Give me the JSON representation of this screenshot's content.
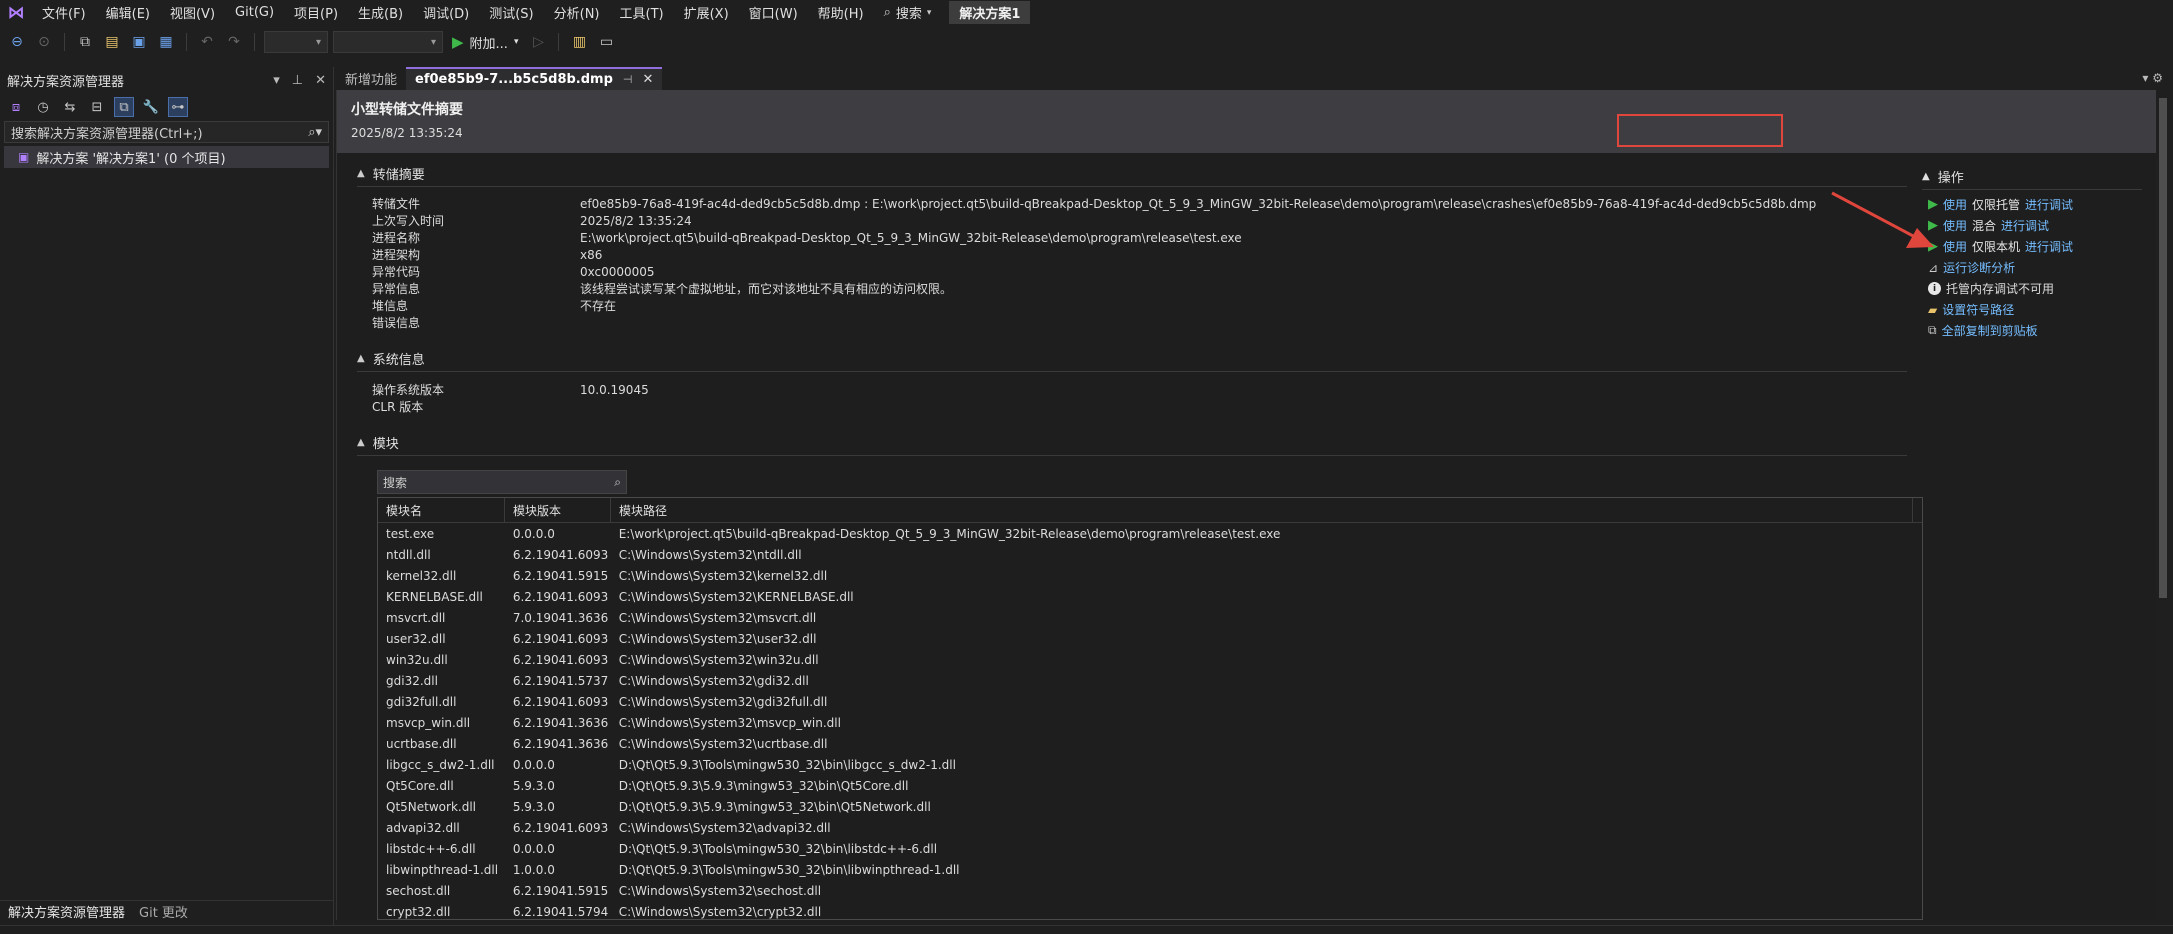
{
  "menubar": {
    "logo": "vs-logo",
    "items": [
      "文件(F)",
      "编辑(E)",
      "视图(V)",
      "Git(G)",
      "项目(P)",
      "生成(B)",
      "调试(D)",
      "测试(S)",
      "分析(N)",
      "工具(T)",
      "扩展(X)",
      "窗口(W)",
      "帮助(H)"
    ],
    "search": "搜索",
    "solution_badge": "解决方案1"
  },
  "toolbar": {
    "attach_label": "附加..."
  },
  "solution_explorer": {
    "title": "解决方案资源管理器",
    "search_placeholder": "搜索解决方案资源管理器(Ctrl+;)",
    "solution_item": "解决方案 '解决方案1' (0 个项目)",
    "bottom_tabs": [
      "解决方案资源管理器",
      "Git 更改"
    ]
  },
  "tabs": [
    {
      "label": "新增功能"
    },
    {
      "label": "ef0e85b9-7...b5c5d8b.dmp"
    }
  ],
  "doc": {
    "title": "小型转储文件摘要",
    "date": "2025/8/2 13:35:24",
    "dump_section": {
      "title": "转储摘要",
      "rows": [
        {
          "label": "转储文件",
          "value": "ef0e85b9-76a8-419f-ac4d-ded9cb5c5d8b.dmp : E:\\work\\project.qt5\\build-qBreakpad-Desktop_Qt_5_9_3_MinGW_32bit-Release\\demo\\program\\release\\crashes\\ef0e85b9-76a8-419f-ac4d-ded9cb5c5d8b.dmp"
        },
        {
          "label": "上次写入时间",
          "value": "2025/8/2 13:35:24"
        },
        {
          "label": "进程名称",
          "value": "E:\\work\\project.qt5\\build-qBreakpad-Desktop_Qt_5_9_3_MinGW_32bit-Release\\demo\\program\\release\\test.exe"
        },
        {
          "label": "进程架构",
          "value": "x86"
        },
        {
          "label": "异常代码",
          "value": "0xc0000005"
        },
        {
          "label": "异常信息",
          "value": "该线程尝试读写某个虚拟地址，而它对该地址不具有相应的访问权限。"
        },
        {
          "label": "堆信息",
          "value": "不存在"
        },
        {
          "label": "错误信息",
          "value": ""
        }
      ]
    },
    "system_section": {
      "title": "系统信息",
      "rows": [
        {
          "label": "操作系统版本",
          "value": "10.0.19045"
        },
        {
          "label": "CLR 版本",
          "value": ""
        }
      ]
    },
    "modules_section": {
      "title": "模块",
      "search_placeholder": "搜索",
      "columns": [
        "模块名",
        "模块版本",
        "模块路径"
      ],
      "rows": [
        [
          "test.exe",
          "0.0.0.0",
          "E:\\work\\project.qt5\\build-qBreakpad-Desktop_Qt_5_9_3_MinGW_32bit-Release\\demo\\program\\release\\test.exe"
        ],
        [
          "ntdll.dll",
          "6.2.19041.6093",
          "C:\\Windows\\System32\\ntdll.dll"
        ],
        [
          "kernel32.dll",
          "6.2.19041.5915",
          "C:\\Windows\\System32\\kernel32.dll"
        ],
        [
          "KERNELBASE.dll",
          "6.2.19041.6093",
          "C:\\Windows\\System32\\KERNELBASE.dll"
        ],
        [
          "msvcrt.dll",
          "7.0.19041.3636",
          "C:\\Windows\\System32\\msvcrt.dll"
        ],
        [
          "user32.dll",
          "6.2.19041.6093",
          "C:\\Windows\\System32\\user32.dll"
        ],
        [
          "win32u.dll",
          "6.2.19041.6093",
          "C:\\Windows\\System32\\win32u.dll"
        ],
        [
          "gdi32.dll",
          "6.2.19041.5737",
          "C:\\Windows\\System32\\gdi32.dll"
        ],
        [
          "gdi32full.dll",
          "6.2.19041.6093",
          "C:\\Windows\\System32\\gdi32full.dll"
        ],
        [
          "msvcp_win.dll",
          "6.2.19041.3636",
          "C:\\Windows\\System32\\msvcp_win.dll"
        ],
        [
          "ucrtbase.dll",
          "6.2.19041.3636",
          "C:\\Windows\\System32\\ucrtbase.dll"
        ],
        [
          "libgcc_s_dw2-1.dll",
          "0.0.0.0",
          "D:\\Qt\\Qt5.9.3\\Tools\\mingw530_32\\bin\\libgcc_s_dw2-1.dll"
        ],
        [
          "Qt5Core.dll",
          "5.9.3.0",
          "D:\\Qt\\Qt5.9.3\\5.9.3\\mingw53_32\\bin\\Qt5Core.dll"
        ],
        [
          "Qt5Network.dll",
          "5.9.3.0",
          "D:\\Qt\\Qt5.9.3\\5.9.3\\mingw53_32\\bin\\Qt5Network.dll"
        ],
        [
          "advapi32.dll",
          "6.2.19041.6093",
          "C:\\Windows\\System32\\advapi32.dll"
        ],
        [
          "libstdc++-6.dll",
          "0.0.0.0",
          "D:\\Qt\\Qt5.9.3\\Tools\\mingw530_32\\bin\\libstdc++-6.dll"
        ],
        [
          "libwinpthread-1.dll",
          "1.0.0.0",
          "D:\\Qt\\Qt5.9.3\\Tools\\mingw530_32\\bin\\libwinpthread-1.dll"
        ],
        [
          "sechost.dll",
          "6.2.19041.5915",
          "C:\\Windows\\System32\\sechost.dll"
        ],
        [
          "crypt32.dll",
          "6.2.19041.5794",
          "C:\\Windows\\System32\\crypt32.dll"
        ]
      ]
    }
  },
  "actions": {
    "title": "操作",
    "items": [
      {
        "pre": "使用",
        "mode": "仅限托管",
        "post": "进行调试"
      },
      {
        "pre": "使用",
        "mode": "混合",
        "post": "进行调试"
      },
      {
        "pre": "使用",
        "mode": "仅限本机",
        "post": "进行调试"
      },
      {
        "label": "运行诊断分析"
      },
      {
        "label": "托管内存调试不可用"
      },
      {
        "label": "设置符号路径"
      },
      {
        "label": "全部复制到剪贴板"
      }
    ]
  },
  "colors": {
    "accent": "#8f6fdc",
    "link": "#75bdff",
    "play": "#3fba4a",
    "highlight": "#e0463c"
  }
}
